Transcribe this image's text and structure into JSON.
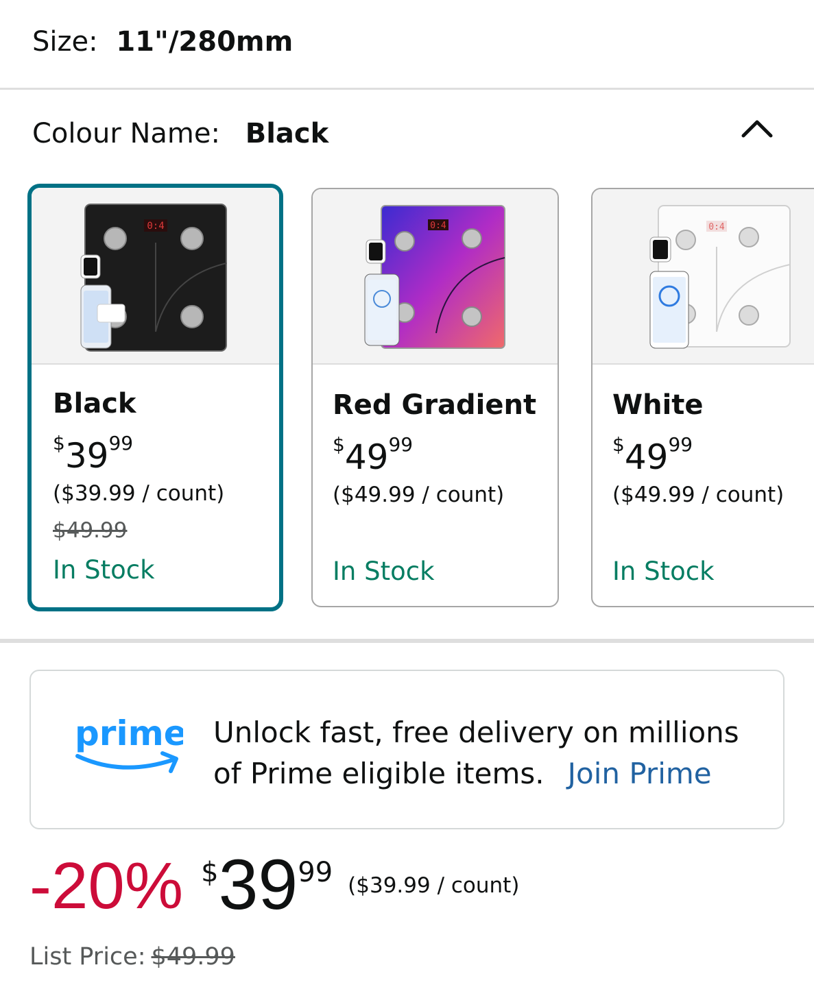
{
  "size": {
    "label": "Size:",
    "value": "11\"/280mm"
  },
  "colour": {
    "label": "Colour Name:",
    "value": "Black"
  },
  "swatches": [
    {
      "name": "Black",
      "price_symbol": "$",
      "price_whole": "39",
      "price_fraction": "99",
      "unit_price": "($39.99 / count)",
      "list_price": "$49.99",
      "availability": "In Stock",
      "selected": true,
      "scale_color": "#1c1c1c",
      "display": "0:4"
    },
    {
      "name": "Red Gradient",
      "price_symbol": "$",
      "price_whole": "49",
      "price_fraction": "99",
      "unit_price": "($49.99 / count)",
      "list_price": "",
      "availability": "In Stock",
      "selected": false,
      "scale_color": "gradient",
      "display": "0:4"
    },
    {
      "name": "White",
      "price_symbol": "$",
      "price_whole": "49",
      "price_fraction": "99",
      "unit_price": "($49.99 / count)",
      "list_price": "",
      "availability": "In Stock",
      "selected": false,
      "scale_color": "#f7f7f7",
      "display": "0:4"
    }
  ],
  "prime": {
    "logo_text": "prime",
    "message_line1": "Unlock fast, free delivery on millions",
    "message_line2": "of Prime eligible items.",
    "join_link": "Join Prime"
  },
  "buybox": {
    "discount": "-20%",
    "price_symbol": "$",
    "price_whole": "39",
    "price_fraction": "99",
    "unit_price": "($39.99 / count)",
    "list_price_label": "List Price:",
    "list_price": "$49.99"
  },
  "colors": {
    "accent": "#007185",
    "in_stock": "#067d62",
    "discount": "#cc0c39",
    "link": "#2162a1",
    "prime_blue": "#1a98ff"
  },
  "icons": {
    "collapse": "chevron-up-icon"
  }
}
